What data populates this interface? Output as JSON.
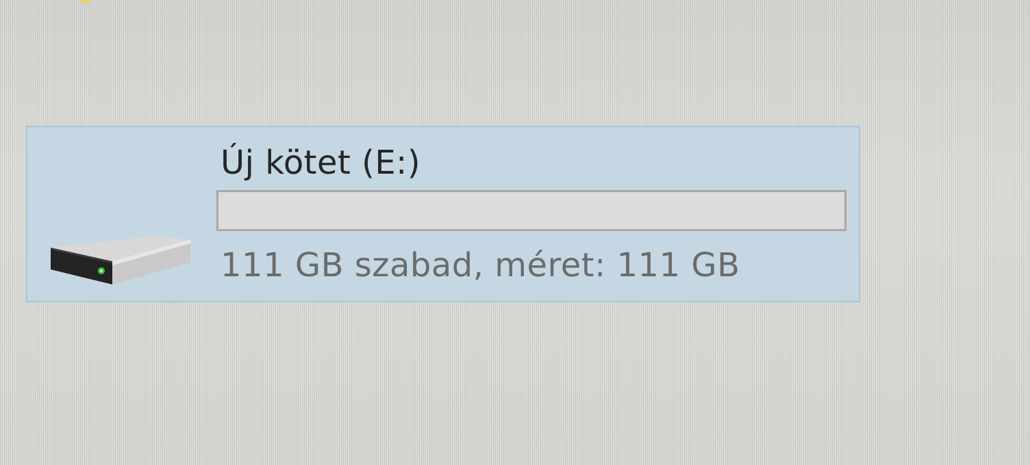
{
  "drive": {
    "name": "Új kötet (E:)",
    "space_text": "111 GB szabad, méret: 111 GB",
    "used_fraction": 0.0
  },
  "colors": {
    "tile_background": "#c5d7e2",
    "bar_fill": "#26a0da"
  },
  "icons": {
    "drive": "hard-drive-icon"
  }
}
